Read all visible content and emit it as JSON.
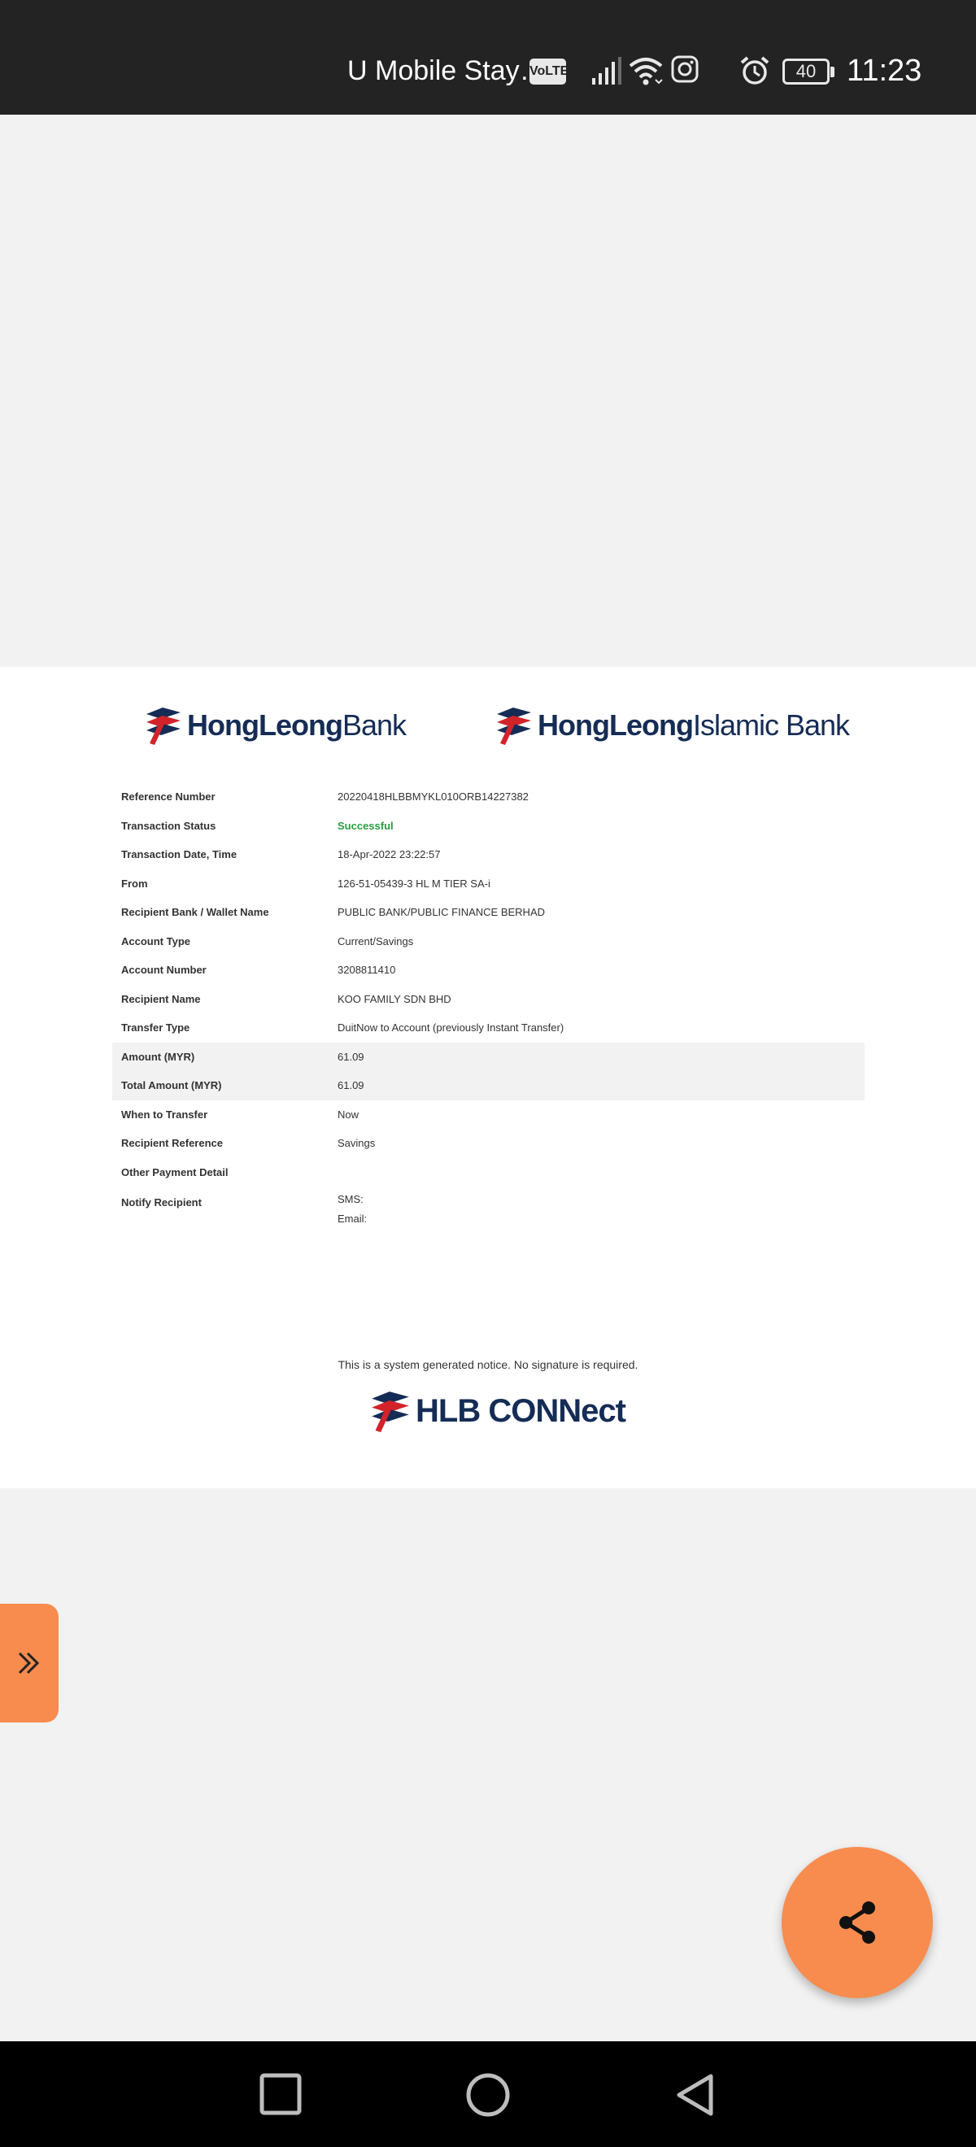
{
  "status_bar": {
    "carrier": "U Mobile Stay…",
    "volte": "VoLTE",
    "battery": "40",
    "time": "11:23",
    "icons": [
      "signal-icon",
      "wifi-icon",
      "instagram-icon",
      "alarm-icon",
      "battery-icon"
    ]
  },
  "logos": {
    "hlb_bold": "HongLeong",
    "hlb_reg": "Bank",
    "hlib_bold": "HongLeong",
    "hlib_reg": "Islamic Bank",
    "connect": "HLB CONNect"
  },
  "details": [
    {
      "label": "Reference Number",
      "value": "20220418HLBBMYKL010ORB14227382"
    },
    {
      "label": "Transaction Status",
      "value": "Successful"
    },
    {
      "label": "Transaction Date, Time",
      "value": "18-Apr-2022 23:22:57"
    },
    {
      "label": "From",
      "value": "126-51-05439-3 HL M TIER SA-i"
    },
    {
      "label": "Recipient Bank / Wallet Name",
      "value": "PUBLIC BANK/PUBLIC FINANCE BERHAD"
    },
    {
      "label": "Account Type",
      "value": "Current/Savings"
    },
    {
      "label": "Account Number",
      "value": "3208811410"
    },
    {
      "label": "Recipient Name",
      "value": "KOO FAMILY SDN BHD"
    },
    {
      "label": "Transfer Type",
      "value": "DuitNow to Account (previously Instant Transfer)"
    },
    {
      "label": "Amount (MYR)",
      "value": "61.09"
    },
    {
      "label": "Total Amount (MYR)",
      "value": "61.09"
    },
    {
      "label": "When to Transfer",
      "value": "Now"
    },
    {
      "label": "Recipient Reference",
      "value": "Savings"
    },
    {
      "label": "Other Payment Detail",
      "value": ""
    },
    {
      "label": "Notify Recipient",
      "value_sms": "SMS:",
      "value_email": "Email:"
    }
  ],
  "notice": "This is a system generated notice. No signature is required.",
  "colors": {
    "accent": "#f78c4e",
    "brand_navy": "#152c55",
    "brand_red": "#d2232a",
    "success": "#27a040"
  },
  "side_tab_icon": "double-chevron-right-icon",
  "fab_icon": "share-icon",
  "nav": [
    "recents-icon",
    "home-icon",
    "back-icon"
  ]
}
